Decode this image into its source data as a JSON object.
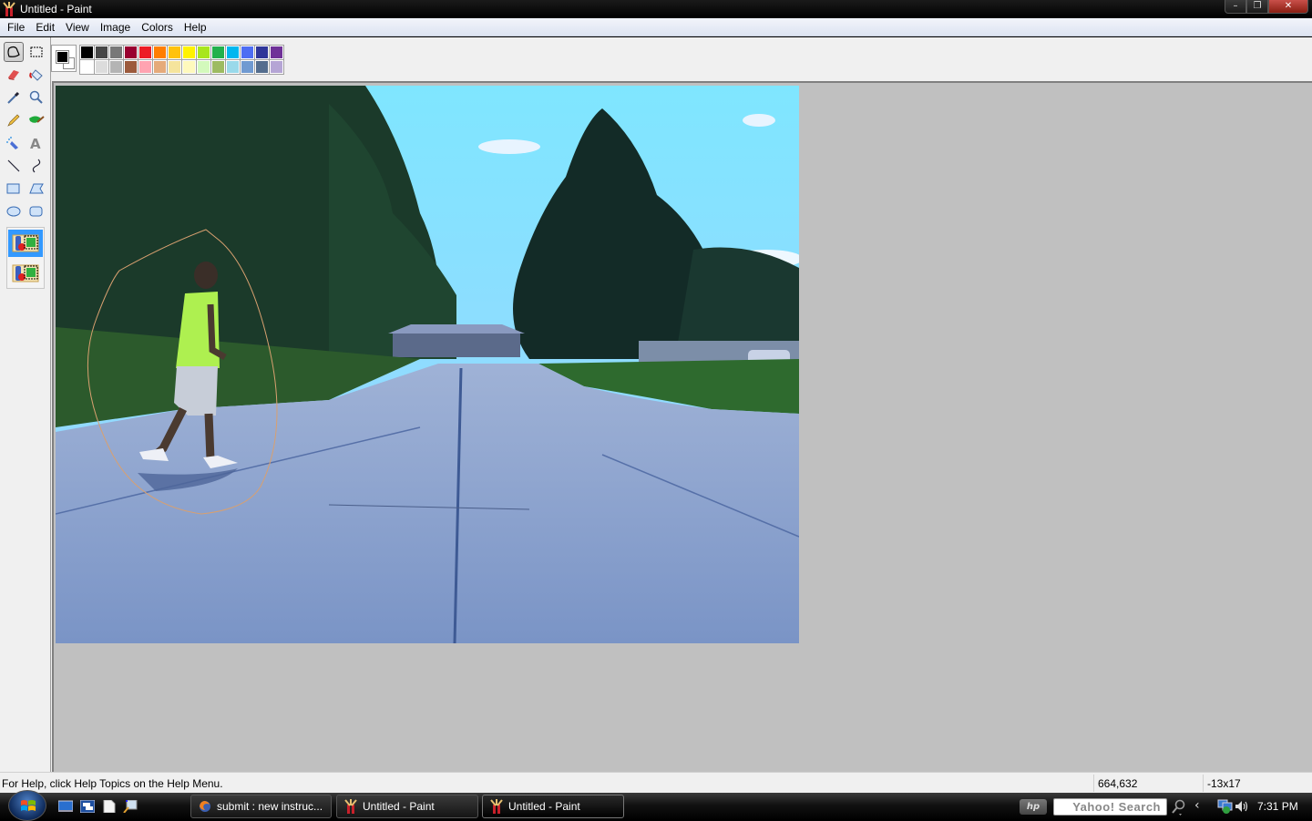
{
  "window": {
    "title": "Untitled - Paint",
    "controls": {
      "minimize": "–",
      "restore": "❐",
      "close": "✕"
    }
  },
  "menu": [
    "File",
    "Edit",
    "View",
    "Image",
    "Colors",
    "Help"
  ],
  "toolbox": {
    "tools": [
      {
        "name": "free-form-select",
        "icon": "lasso-icon",
        "selected": true
      },
      {
        "name": "select",
        "icon": "rect-select-icon",
        "selected": false
      },
      {
        "name": "eraser",
        "icon": "eraser-icon",
        "selected": false
      },
      {
        "name": "fill-with-color",
        "icon": "paint-bucket-icon",
        "selected": false
      },
      {
        "name": "pick-color",
        "icon": "eyedropper-icon",
        "selected": false
      },
      {
        "name": "magnifier",
        "icon": "magnifier-icon",
        "selected": false
      },
      {
        "name": "pencil",
        "icon": "pencil-icon",
        "selected": false
      },
      {
        "name": "brush",
        "icon": "brush-icon",
        "selected": false
      },
      {
        "name": "airbrush",
        "icon": "airbrush-icon",
        "selected": false
      },
      {
        "name": "text",
        "icon": "text-icon",
        "selected": false
      },
      {
        "name": "line",
        "icon": "line-icon",
        "selected": false
      },
      {
        "name": "curve",
        "icon": "curve-icon",
        "selected": false
      },
      {
        "name": "rectangle",
        "icon": "rectangle-icon",
        "selected": false
      },
      {
        "name": "polygon",
        "icon": "polygon-icon",
        "selected": false
      },
      {
        "name": "ellipse",
        "icon": "ellipse-icon",
        "selected": false
      },
      {
        "name": "rounded-rectangle",
        "icon": "rounded-rectangle-icon",
        "selected": false
      }
    ],
    "options": [
      {
        "name": "opaque-selection",
        "active": true
      },
      {
        "name": "transparent-selection",
        "active": false
      }
    ]
  },
  "colors": {
    "foreground": "#000000",
    "background": "#ffffff",
    "palette_top": [
      "#000000",
      "#464646",
      "#787878",
      "#990030",
      "#ed1c24",
      "#ff7e00",
      "#ffc20e",
      "#fff200",
      "#a8e61d",
      "#22b14c",
      "#00b7ef",
      "#4d6df3",
      "#2f3699",
      "#6f3198"
    ],
    "palette_bottom": [
      "#ffffff",
      "#dcdcdc",
      "#b4b4b4",
      "#9c5a3c",
      "#ffa3b1",
      "#e5aa7a",
      "#f5e49c",
      "#fff9bd",
      "#d3f9bc",
      "#9dbb61",
      "#99d9ea",
      "#709ad1",
      "#546d8e",
      "#b5a5d5"
    ]
  },
  "canvas": {
    "image_description": "Photo of a teenager in a lime-green t-shirt and khaki shorts walking across a residential concrete street lined with trees under a blue sky",
    "selection": "free-form lasso outline around the walking person"
  },
  "status": {
    "help": "For Help, click Help Topics on the Help Menu.",
    "cursor_position": "664,632",
    "selection_size": "-13x17"
  },
  "taskbar": {
    "quick_launch": [
      "show-desktop-icon",
      "switch-windows-icon",
      "document-icon",
      "search-computer-icon"
    ],
    "buttons": [
      {
        "label": "submit : new instruc...",
        "icon": "firefox-icon",
        "active": false
      },
      {
        "label": "Untitled - Paint",
        "icon": "paint-icon",
        "active": false
      },
      {
        "label": "Untitled - Paint",
        "icon": "paint-icon",
        "active": true
      }
    ],
    "search_placeholder": "Yahoo! Search",
    "clock": "7:31 PM"
  }
}
